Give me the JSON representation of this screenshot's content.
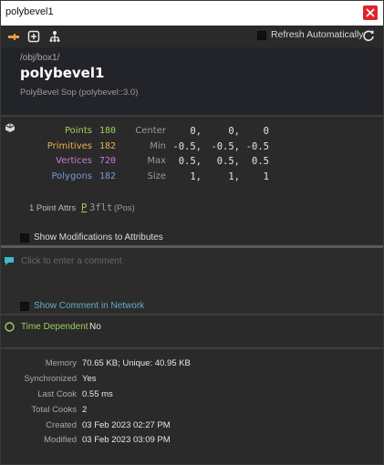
{
  "window": {
    "title": "polybevel1"
  },
  "toolbar": {
    "icons": [
      "pin-icon",
      "new-window-icon",
      "tree-icon"
    ],
    "refresh_label": "Refresh Automatically",
    "refresh_checked": false
  },
  "header": {
    "path": "/obj/box1/",
    "node_name": "polybevel1",
    "node_type": "PolyBevel Sop (polybevel::3.0)"
  },
  "geometry": {
    "rows": [
      {
        "label": "Points",
        "value": "180",
        "color": "#9fcf5a"
      },
      {
        "label": "Primitives",
        "value": "182",
        "color": "#e8b04a"
      },
      {
        "label": "Vertices",
        "value": "720",
        "color": "#c87ad6"
      },
      {
        "label": "Polygons",
        "value": "182",
        "color": "#7a9ad8"
      }
    ],
    "bounds": [
      {
        "label": "Center",
        "values": [
          "0,",
          "0,",
          "0"
        ]
      },
      {
        "label": "Min",
        "values": [
          "-0.5,",
          "-0.5,",
          "-0.5"
        ]
      },
      {
        "label": "Max",
        "values": [
          "0.5,",
          "0.5,",
          "0.5"
        ]
      },
      {
        "label": "Size",
        "values": [
          "1,",
          "1,",
          "1"
        ]
      }
    ],
    "attrs": {
      "label": "1 Point Attrs",
      "class_letter": "P",
      "type": "3flt",
      "name": "(Pos)"
    },
    "show_modifications_label": "Show Modifications to Attributes"
  },
  "comment": {
    "placeholder": "Click to enter a comment",
    "show_in_network_label": "Show Comment in Network"
  },
  "time_dependent": {
    "label": "Time Dependent",
    "value": "No"
  },
  "info": [
    {
      "label": "Memory",
      "value": "70.65 KB; Unique: 40.95 KB"
    },
    {
      "label": "Synchronized",
      "value": "Yes"
    },
    {
      "label": "Last Cook",
      "value": "0.55 ms"
    },
    {
      "label": "Total Cooks",
      "value": "2"
    },
    {
      "label": "Created",
      "value": "03 Feb 2023 02:27 PM"
    },
    {
      "label": "Modified",
      "value": "03 Feb 2023 03:09 PM"
    }
  ]
}
